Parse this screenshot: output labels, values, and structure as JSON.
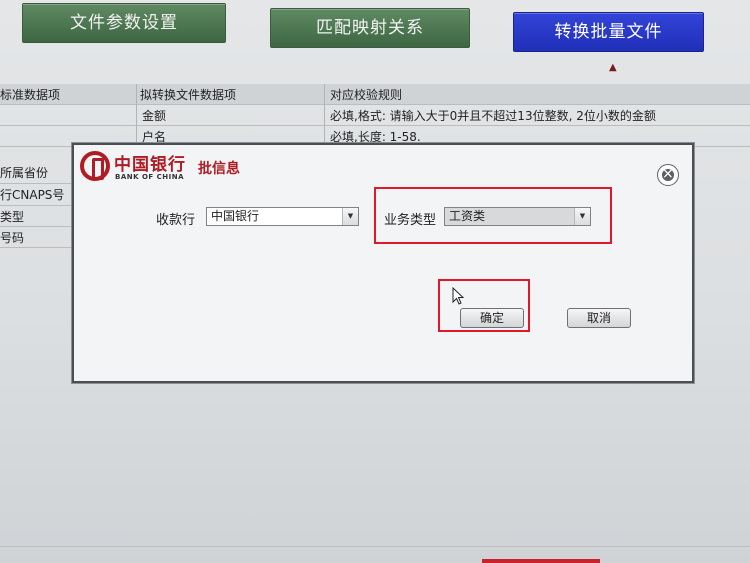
{
  "tabs": [
    {
      "label": "文件参数设置"
    },
    {
      "label": "匹配映射关系"
    },
    {
      "label": "转换批量文件"
    }
  ],
  "table": {
    "headers": [
      "标准数据项",
      "拟转换文件数据项",
      "对应校验规则"
    ],
    "rows": [
      {
        "item": "金额",
        "rule": "必填,格式: 请输入大于0并且不超过13位整数, 2位小数的金额"
      },
      {
        "item": "户名",
        "rule": "必填,长度: 1-58."
      }
    ],
    "left_labels": [
      "所属省份",
      "行CNAPS号",
      "类型",
      "号码"
    ]
  },
  "dialog": {
    "logo_cn": "中国银行",
    "logo_en": "BANK OF CHINA",
    "title": "批信息",
    "payee_bank_label": "收款行",
    "payee_bank_value": "中国银行",
    "business_type_label": "业务类型",
    "business_type_value": "工资类",
    "confirm_label": "确定",
    "cancel_label": "取消"
  },
  "colors": {
    "highlight": "#e0182a",
    "brand_red": "#b01c24",
    "active_tab": "#2a3bd0"
  }
}
